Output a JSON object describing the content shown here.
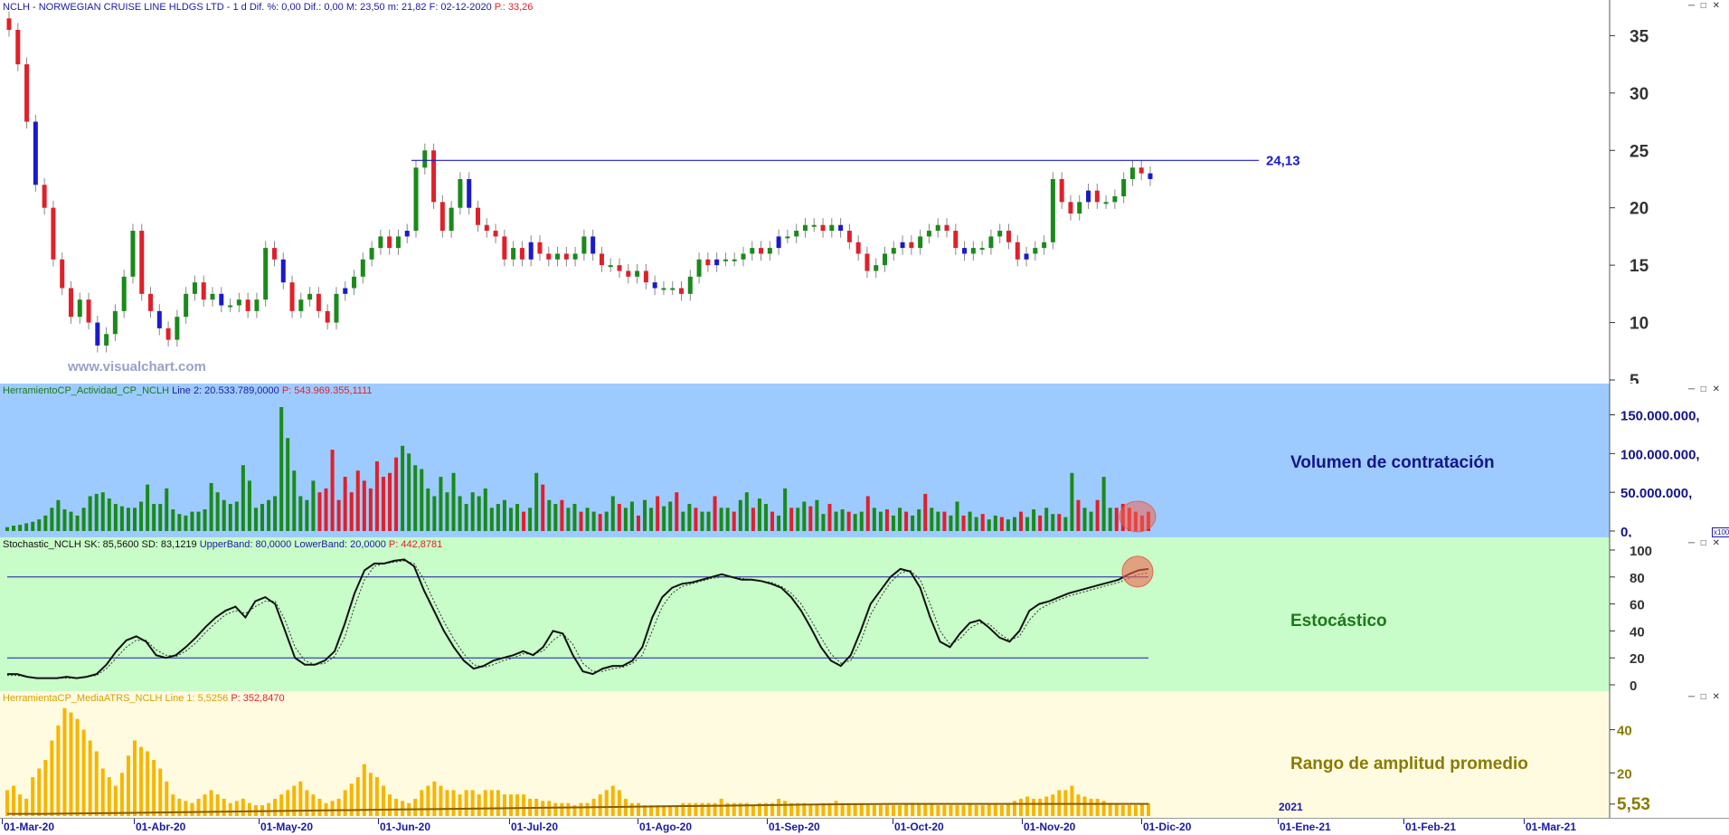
{
  "header": {
    "symbol": "NCLH - NORWEGIAN CRUISE LINE HLDGS LTD -",
    "period": "1 d",
    "dif_pct": "Dif. %: 0,00",
    "dif": "Dif.: 0,00",
    "max": "M: 23,50",
    "min": "m: 21,82",
    "date": "F: 02-12-2020",
    "price": "P.: 33,26",
    "window_controls": "─ □ ✕"
  },
  "watermark": "www.visualchart.com",
  "colors": {
    "up": "#1a8a1a",
    "down": "#e0202a",
    "blue": "#1a1acc",
    "resistance": "#1a1acc"
  },
  "panes": {
    "price": {
      "resistance_label": "24,13"
    },
    "volume": {
      "indicator": "HerramientoCP_Actividad_CP_NCLH",
      "line": "Line 2: 20.533.789,0000",
      "p": "P: 543.969.355,1111",
      "title": "Volumen de contratación",
      "scale_note": "x100"
    },
    "stochastic": {
      "indicator": "Stochastic_NCLH",
      "sk": "SK: 85,5600",
      "sd": "SD: 83,1219",
      "upper": "UpperBand: 80,0000",
      "lower": "LowerBand: 20,0000",
      "p": "P: 442,8781",
      "title": "Estocástico"
    },
    "atr": {
      "indicator": "HerramientaCP_MediaATRS_NCLH",
      "line": "Line 1: 5,5256",
      "p": "P: 352,8470",
      "title": "Rango de amplitud promedio",
      "last_value": "5,53",
      "year_marker": "2021"
    }
  },
  "chart_data": [
    {
      "type": "candlestick",
      "title": "NCLH - NORWEGIAN CRUISE LINE HLDGS LTD",
      "yticks": [
        "35",
        "30",
        "25",
        "20",
        "15",
        "10",
        "5"
      ],
      "ylim": [
        5,
        37
      ],
      "resistance": 24.13,
      "x_labels": [
        "01-Mar-20",
        "01-Abr-20",
        "01-May-20",
        "01-Jun-20",
        "01-Jul-20",
        "01-Ago-20",
        "01-Sep-20",
        "01-Oct-20",
        "01-Nov-20",
        "01-Dic-20",
        "01-Ene-21",
        "01-Feb-21",
        "01-Mar-21"
      ],
      "close": [
        35.5,
        32.5,
        27.5,
        22.0,
        20.0,
        15.5,
        13.0,
        10.5,
        12.0,
        10.0,
        8.0,
        9.0,
        11.0,
        14.0,
        18.0,
        12.5,
        11.0,
        9.5,
        8.5,
        10.5,
        12.5,
        13.5,
        12.0,
        12.5,
        11.5,
        11.5,
        12.0,
        11.0,
        12.0,
        16.5,
        15.5,
        13.5,
        11.0,
        12.0,
        12.5,
        11.0,
        10.0,
        12.5,
        13.0,
        14.0,
        15.5,
        16.5,
        17.5,
        16.5,
        17.5,
        18.0,
        23.5,
        25.0,
        20.5,
        18.0,
        20.0,
        22.5,
        20.0,
        18.5,
        18.0,
        17.5,
        15.5,
        16.5,
        15.5,
        17.0,
        16.0,
        15.5,
        16.0,
        15.5,
        16.0,
        17.5,
        16.0,
        15.0,
        15.0,
        14.5,
        14.0,
        14.5,
        13.5,
        13.0,
        13.0,
        13.0,
        12.5,
        14.0,
        15.5,
        15.0,
        15.5,
        15.5,
        15.5,
        16.0,
        16.5,
        16.0,
        16.5,
        17.5,
        17.5,
        18.0,
        18.5,
        18.5,
        18.0,
        18.5,
        18.0,
        17.0,
        16.0,
        14.5,
        15.0,
        16.0,
        16.5,
        17.0,
        16.5,
        17.5,
        18.0,
        18.5,
        18.0,
        16.5,
        16.0,
        16.5,
        16.5,
        17.5,
        18.0,
        17.0,
        15.5,
        16.0,
        16.5,
        17.0,
        22.5,
        20.5,
        19.5,
        20.5,
        21.5,
        20.5,
        20.5,
        21.0,
        22.5,
        23.5,
        23.0,
        22.5
      ]
    },
    {
      "type": "bar",
      "title": "Volumen de contratación",
      "yticks": [
        "150.000.000,",
        "100.000.000,",
        "50.000.000,",
        "0,"
      ],
      "ylim": [
        0,
        160000000
      ],
      "values": [
        5,
        7,
        8,
        10,
        12,
        15,
        20,
        30,
        40,
        28,
        25,
        20,
        30,
        45,
        48,
        50,
        42,
        35,
        32,
        30,
        30,
        38,
        60,
        35,
        35,
        55,
        28,
        22,
        20,
        25,
        25,
        28,
        62,
        50,
        40,
        35,
        38,
        85,
        65,
        30,
        35,
        40,
        45,
        160,
        120,
        78,
        45,
        40,
        65,
        50,
        55,
        105,
        40,
        70,
        50,
        78,
        65,
        55,
        90,
        70,
        75,
        95,
        110,
        100,
        85,
        80,
        55,
        45,
        70,
        50,
        75,
        45,
        35,
        50,
        45,
        55,
        30,
        35,
        40,
        30,
        35,
        25,
        30,
        75,
        60,
        40,
        35,
        40,
        30,
        35,
        25,
        30,
        25,
        22,
        25,
        45,
        35,
        30,
        38,
        20,
        40,
        30,
        45,
        32,
        38,
        50,
        25,
        35,
        30,
        25,
        25,
        45,
        30,
        30,
        25,
        40,
        50,
        30,
        42,
        35,
        25,
        20,
        55,
        30,
        30,
        38,
        32,
        40,
        22,
        35,
        25,
        28,
        25,
        22,
        25,
        45,
        30,
        25,
        28,
        20,
        30,
        25,
        20,
        28,
        48,
        30,
        25,
        25,
        20,
        38,
        20,
        25,
        18,
        22,
        15,
        20,
        18,
        15,
        18,
        25,
        18,
        28,
        20,
        30,
        22,
        22,
        18,
        75,
        40,
        30,
        25,
        40,
        70,
        30,
        30,
        35,
        30,
        25,
        20,
        25
      ],
      "unit": "millions"
    },
    {
      "type": "line",
      "title": "Estocástico",
      "yticks": [
        "100",
        "80",
        "60",
        "40",
        "20",
        "0"
      ],
      "ylim": [
        0,
        100
      ],
      "bands": [
        80,
        20
      ],
      "series": [
        {
          "name": "SK",
          "values": [
            8,
            8,
            6,
            5,
            5,
            5,
            6,
            5,
            6,
            8,
            15,
            25,
            33,
            36,
            32,
            22,
            20,
            22,
            28,
            35,
            43,
            50,
            55,
            58,
            50,
            62,
            65,
            60,
            40,
            20,
            15,
            15,
            18,
            25,
            45,
            68,
            85,
            90,
            90,
            92,
            93,
            88,
            70,
            55,
            40,
            28,
            18,
            12,
            14,
            18,
            20,
            22,
            25,
            22,
            28,
            40,
            38,
            22,
            10,
            8,
            12,
            14,
            14,
            18,
            28,
            50,
            65,
            72,
            75,
            76,
            78,
            80,
            82,
            80,
            78,
            78,
            77,
            75,
            72,
            65,
            55,
            42,
            28,
            18,
            14,
            22,
            40,
            60,
            70,
            80,
            86,
            84,
            72,
            50,
            32,
            28,
            38,
            46,
            48,
            42,
            35,
            32,
            40,
            55,
            60,
            62,
            65,
            68,
            70,
            72,
            74,
            76,
            78,
            82,
            85,
            86
          ]
        },
        {
          "name": "SD",
          "values": [
            7,
            7,
            6,
            5,
            5,
            5,
            5,
            5,
            6,
            7,
            12,
            20,
            28,
            33,
            33,
            26,
            22,
            21,
            25,
            31,
            39,
            46,
            52,
            55,
            53,
            58,
            62,
            62,
            48,
            28,
            18,
            15,
            16,
            21,
            35,
            58,
            78,
            88,
            90,
            91,
            92,
            90,
            78,
            62,
            47,
            34,
            23,
            15,
            13,
            15,
            18,
            20,
            23,
            23,
            25,
            33,
            38,
            30,
            16,
            10,
            10,
            12,
            13,
            16,
            22,
            40,
            58,
            68,
            73,
            75,
            77,
            79,
            80,
            80,
            79,
            78,
            77,
            76,
            73,
            68,
            60,
            48,
            35,
            23,
            16,
            18,
            32,
            52,
            65,
            76,
            83,
            85,
            78,
            60,
            40,
            30,
            34,
            42,
            46,
            45,
            38,
            33,
            36,
            48,
            56,
            60,
            63,
            66,
            68,
            70,
            72,
            74,
            76,
            79,
            82,
            83
          ]
        }
      ]
    },
    {
      "type": "bar",
      "title": "Rango de amplitud promedio",
      "yticks": [
        "40",
        "20",
        "5,53"
      ],
      "ylim": [
        0,
        52
      ],
      "values": [
        12,
        14,
        10,
        8,
        18,
        22,
        26,
        35,
        42,
        50,
        48,
        45,
        40,
        35,
        30,
        22,
        18,
        14,
        20,
        28,
        35,
        32,
        30,
        26,
        22,
        16,
        10,
        8,
        7,
        6,
        8,
        10,
        12,
        10,
        8,
        6,
        7,
        8,
        6,
        5,
        5,
        6,
        8,
        10,
        12,
        14,
        16,
        12,
        10,
        8,
        6,
        7,
        8,
        12,
        15,
        18,
        24,
        20,
        18,
        14,
        10,
        8,
        7,
        6,
        8,
        12,
        14,
        16,
        14,
        12,
        12,
        10,
        12,
        12,
        10,
        12,
        12,
        12,
        10,
        10,
        10,
        10,
        8,
        8,
        7,
        7,
        6,
        6,
        6,
        5,
        6,
        6,
        8,
        10,
        12,
        14,
        12,
        8,
        6,
        6,
        5,
        5,
        5,
        5,
        5,
        5,
        6,
        6,
        6,
        6,
        6,
        6,
        8,
        6,
        6,
        6,
        6,
        5,
        6,
        6,
        6,
        8,
        7,
        6,
        6,
        6,
        5,
        5,
        6,
        6,
        7,
        6,
        6,
        6,
        6,
        5,
        5,
        5,
        5,
        5,
        5,
        6,
        6,
        6,
        6,
        6,
        5,
        5,
        5,
        5,
        5,
        6,
        5,
        5,
        6,
        6,
        5,
        6,
        7,
        8,
        9,
        8,
        8,
        9,
        10,
        12,
        12,
        14,
        10,
        9,
        8,
        8,
        7,
        6,
        6,
        5,
        5,
        5,
        6,
        6
      ],
      "average_line": [
        1,
        1,
        1.2,
        1.4,
        1.6,
        1.8,
        2,
        2.2,
        2.4,
        2.6,
        2.8,
        3,
        3.2,
        3.4,
        3.6,
        3.8,
        4,
        4.2,
        4.4,
        4.6,
        4.8,
        5,
        5.2,
        5.4,
        5.5,
        5.6,
        5.6,
        5.6,
        5.6,
        5.6,
        5.6,
        5.6,
        5.6
      ]
    }
  ]
}
